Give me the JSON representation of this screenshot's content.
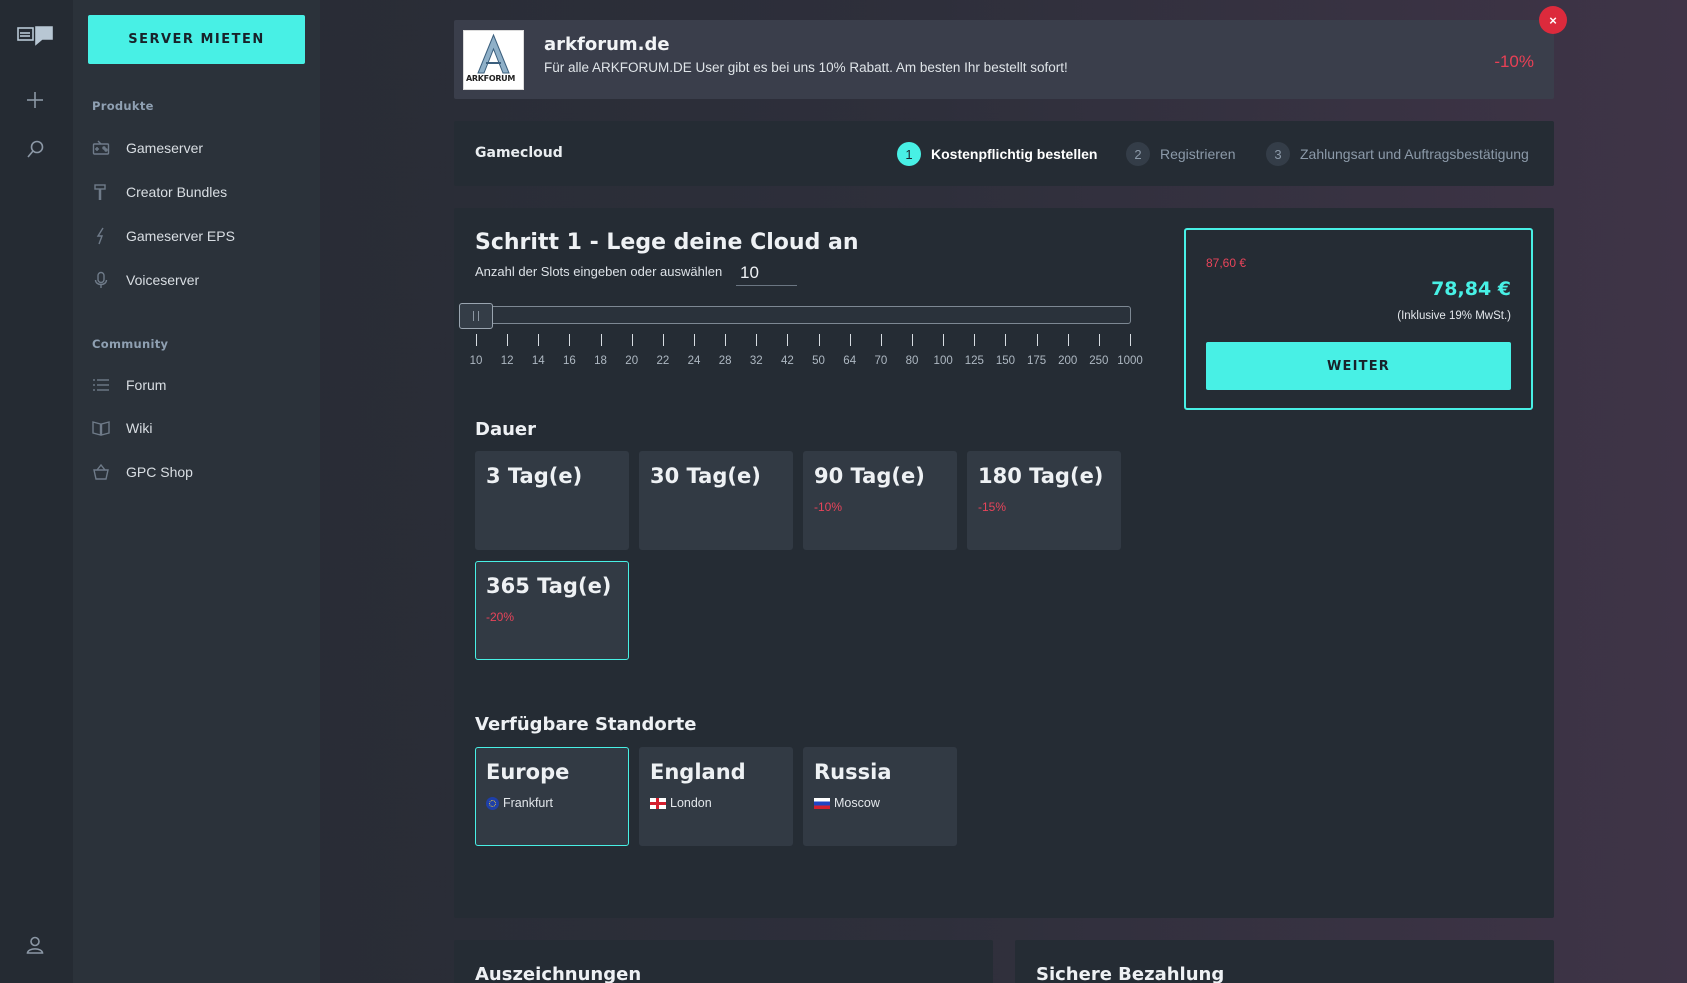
{
  "sidebar": {
    "cta_label": "SERVER MIETEN",
    "sections": [
      {
        "label": "Produkte",
        "items": [
          {
            "label": "Gameserver",
            "icon": "gamepad-icon"
          },
          {
            "label": "Creator Bundles",
            "icon": "hammer-icon"
          },
          {
            "label": "Gameserver EPS",
            "icon": "lightning-icon"
          },
          {
            "label": "Voiceserver",
            "icon": "microphone-icon"
          }
        ]
      },
      {
        "label": "Community",
        "items": [
          {
            "label": "Forum",
            "icon": "list-icon"
          },
          {
            "label": "Wiki",
            "icon": "book-icon"
          },
          {
            "label": "GPC Shop",
            "icon": "basket-icon"
          }
        ]
      }
    ]
  },
  "promo": {
    "title": "arkforum.de",
    "text": "Für alle ARKFORUM.DE User gibt es bei uns 10% Rabatt. Am besten Ihr bestellt sofort!",
    "discount": "-10%",
    "close_label": "×",
    "logo_text": "ARKFORUM"
  },
  "steps": {
    "title": "Gamecloud",
    "items": [
      {
        "num": "1",
        "label": "Kostenpflichtig bestellen",
        "active": true
      },
      {
        "num": "2",
        "label": "Registrieren",
        "active": false
      },
      {
        "num": "3",
        "label": "Zahlungsart und Auftragsbestätigung",
        "active": false
      }
    ]
  },
  "config": {
    "heading": "Schritt 1 - Lege deine Cloud an",
    "slots_label": "Anzahl der Slots eingeben oder auswählen",
    "slots_value": "10",
    "slider_value": 10,
    "ticks": [
      "10",
      "12",
      "14",
      "16",
      "18",
      "20",
      "22",
      "24",
      "28",
      "32",
      "42",
      "50",
      "64",
      "70",
      "80",
      "100",
      "125",
      "150",
      "175",
      "200",
      "250",
      "1000"
    ],
    "duration_heading": "Dauer",
    "durations": [
      {
        "label": "3 Tag(e)",
        "discount": "",
        "selected": false
      },
      {
        "label": "30 Tag(e)",
        "discount": "",
        "selected": false
      },
      {
        "label": "90 Tag(e)",
        "discount": "-10%",
        "selected": false
      },
      {
        "label": "180 Tag(e)",
        "discount": "-15%",
        "selected": false
      },
      {
        "label": "365 Tag(e)",
        "discount": "-20%",
        "selected": true
      }
    ],
    "locations_heading": "Verfügbare Standorte",
    "locations": [
      {
        "region": "Europe",
        "city": "Frankfurt",
        "flag": "eu-flag-icon",
        "selected": true
      },
      {
        "region": "England",
        "city": "London",
        "flag": "england-flag-icon",
        "selected": false
      },
      {
        "region": "Russia",
        "city": "Moscow",
        "flag": "russia-flag-icon",
        "selected": false
      }
    ]
  },
  "price": {
    "old": "87,60 €",
    "new": "78,84 €",
    "tax_note": "(Inklusive 19% MwSt.)",
    "button_label": "WEITER"
  },
  "bottom": {
    "awards_title": "Auszeichnungen",
    "payment_title": "Sichere Bezahlung"
  },
  "colors": {
    "accent": "#48f0e5",
    "discount_red": "#e8445a",
    "close_red": "#dc2a3c"
  }
}
